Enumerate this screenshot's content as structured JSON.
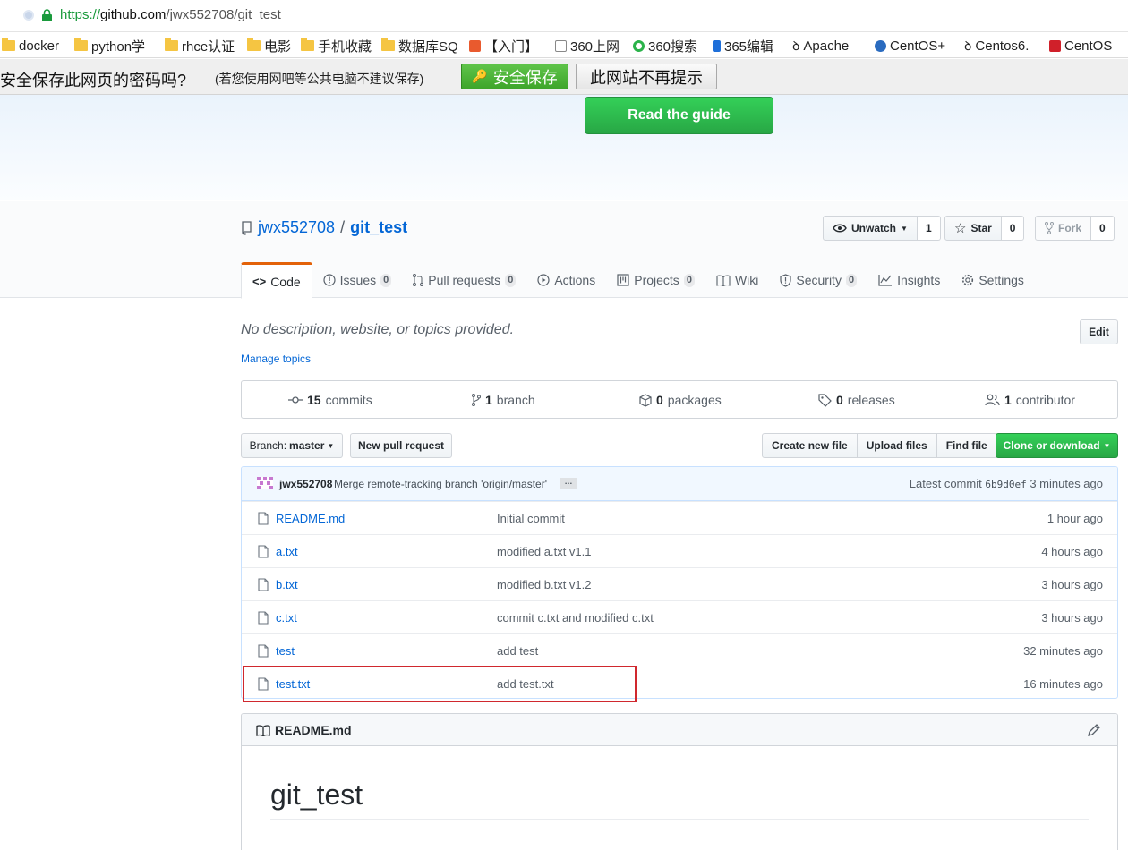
{
  "browser": {
    "url_proto": "https://",
    "url_host": "github.com",
    "url_path": "/jwx552708/git_test",
    "bookmarks": [
      {
        "label": "docker",
        "icon": "folder-icon"
      },
      {
        "label": "python学",
        "icon": "folder-icon"
      },
      {
        "label": "rhce认证",
        "icon": "folder-icon"
      },
      {
        "label": "电影",
        "icon": "folder-icon"
      },
      {
        "label": "手机收藏",
        "icon": "folder-icon"
      },
      {
        "label": "数据库SQ",
        "icon": "folder-icon"
      },
      {
        "label": "【入门】",
        "icon": "site-icon"
      },
      {
        "label": "360上网",
        "icon": "page-icon"
      },
      {
        "label": "360搜索",
        "icon": "search-icon"
      },
      {
        "label": "365编辑",
        "icon": "site-icon"
      },
      {
        "label": "Apache",
        "icon": "feather-icon"
      },
      {
        "label": "CentOS+",
        "icon": "site-icon"
      },
      {
        "label": "Centos6.",
        "icon": "feather-icon"
      },
      {
        "label": "CentOS",
        "icon": "site-icon"
      }
    ],
    "password_prompt": {
      "question": "安全保存此网页的密码吗?",
      "hint": "(若您使用网吧等公共电脑不建议保存)",
      "save_label": "安全保存",
      "never_label": "此网站不再提示"
    }
  },
  "hero": {
    "guide_label": "Read the guide"
  },
  "repo": {
    "owner": "jwx552708",
    "separator": "/",
    "name": "git_test",
    "watch_label": "Unwatch",
    "watch_count": "1",
    "star_label": "Star",
    "star_count": "0",
    "fork_label": "Fork",
    "fork_count": "0"
  },
  "tabs": [
    {
      "label": "Code",
      "count": ""
    },
    {
      "label": "Issues",
      "count": "0"
    },
    {
      "label": "Pull requests",
      "count": "0"
    },
    {
      "label": "Actions",
      "count": ""
    },
    {
      "label": "Projects",
      "count": "0"
    },
    {
      "label": "Wiki",
      "count": ""
    },
    {
      "label": "Security",
      "count": "0"
    },
    {
      "label": "Insights",
      "count": ""
    },
    {
      "label": "Settings",
      "count": ""
    }
  ],
  "about": {
    "description": "No description, website, or topics provided.",
    "manage_topics": "Manage topics",
    "edit_label": "Edit"
  },
  "summary": {
    "commits_num": "15",
    "commits_label": "commits",
    "branch_num": "1",
    "branch_label": "branch",
    "packages_num": "0",
    "packages_label": "packages",
    "releases_num": "0",
    "releases_label": "releases",
    "contributor_num": "1",
    "contributor_label": "contributor"
  },
  "toolbar": {
    "branch_prefix": "Branch:",
    "branch_name": "master",
    "new_pr": "New pull request",
    "create_file": "Create new file",
    "upload_files": "Upload files",
    "find_file": "Find file",
    "clone": "Clone or download"
  },
  "latest_commit": {
    "author": "jwx552708",
    "message": "Merge remote-tracking branch 'origin/master'",
    "ellipsis": "…",
    "prefix": "Latest commit",
    "sha": "6b9d0ef",
    "time": "3 minutes ago"
  },
  "files": [
    {
      "name": "README.md",
      "message": "Initial commit",
      "age": "1 hour ago"
    },
    {
      "name": "a.txt",
      "message": "modified a.txt v1.1",
      "age": "4 hours ago"
    },
    {
      "name": "b.txt",
      "message": "modified b.txt v1.2",
      "age": "3 hours ago"
    },
    {
      "name": "c.txt",
      "message": "commit c.txt and modified c.txt",
      "age": "3 hours ago"
    },
    {
      "name": "test",
      "message": "add test",
      "age": "32 minutes ago"
    },
    {
      "name": "test.txt",
      "message": "add test.txt",
      "age": "16 minutes ago"
    }
  ],
  "readme": {
    "file_label": "README.md",
    "heading": "git_test"
  },
  "colors": {
    "accent_green": "#28a745",
    "link_blue": "#0366d6",
    "tab_orange": "#e36209",
    "highlight_red": "#d0282e"
  }
}
